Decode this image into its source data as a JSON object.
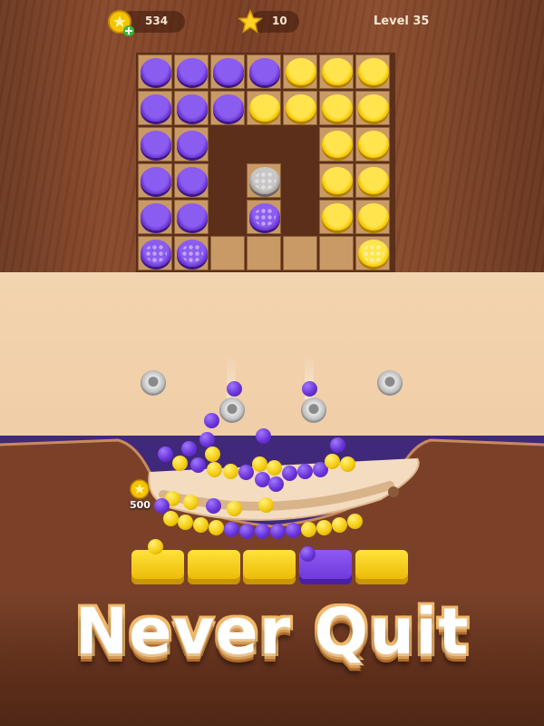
{
  "hud": {
    "coins": "534",
    "stars": "10",
    "level": "Level 35"
  },
  "track": {
    "reward": "500"
  },
  "banner": {
    "title": "Never Quit"
  },
  "colors": {
    "purple": "#6b35d6",
    "yellow": "#f5c800",
    "wood": "#8a4a2c"
  }
}
